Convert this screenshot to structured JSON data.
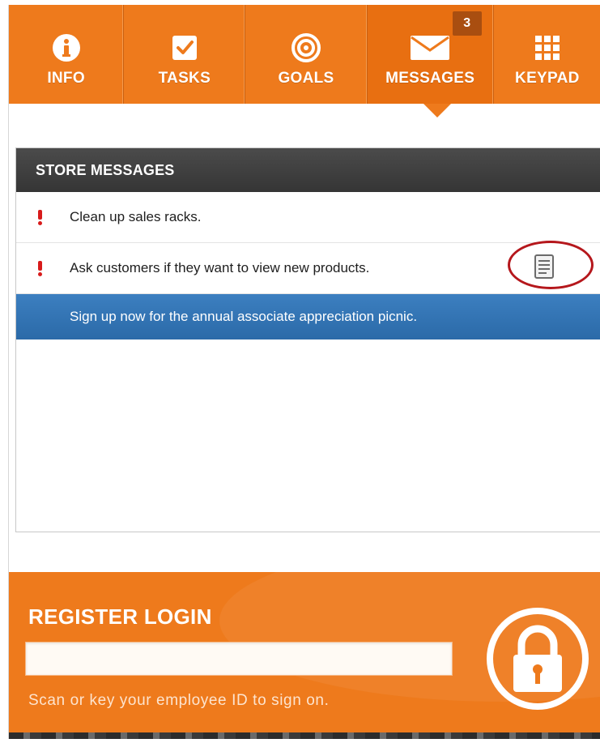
{
  "nav": {
    "tabs": [
      {
        "label": "INFO",
        "icon": "info-icon"
      },
      {
        "label": "TASKS",
        "icon": "checkbox-icon"
      },
      {
        "label": "GOALS",
        "icon": "target-icon"
      },
      {
        "label": "MESSAGES",
        "icon": "envelope-icon",
        "badge": "3",
        "active": true
      },
      {
        "label": "KEYPAD",
        "icon": "keypad-icon"
      }
    ]
  },
  "messages": {
    "header": "STORE MESSAGES",
    "items": [
      {
        "text": "Clean up sales racks.",
        "priority": "high"
      },
      {
        "text": "Ask customers if they want to view new products.",
        "priority": "high",
        "icon": "document-icon"
      },
      {
        "text": "Sign up now for the annual associate appreciation picnic.",
        "selected": true
      }
    ]
  },
  "login": {
    "title": "REGISTER LOGIN",
    "input_value": "",
    "hint": "Scan or key your employee ID to sign on.",
    "icon": "lock-icon"
  },
  "colors": {
    "brand_orange": "#ee7a1c",
    "header_dark": "#3f3f3f",
    "selected_blue": "#2f72b3",
    "alert_red": "#d81b1b"
  }
}
